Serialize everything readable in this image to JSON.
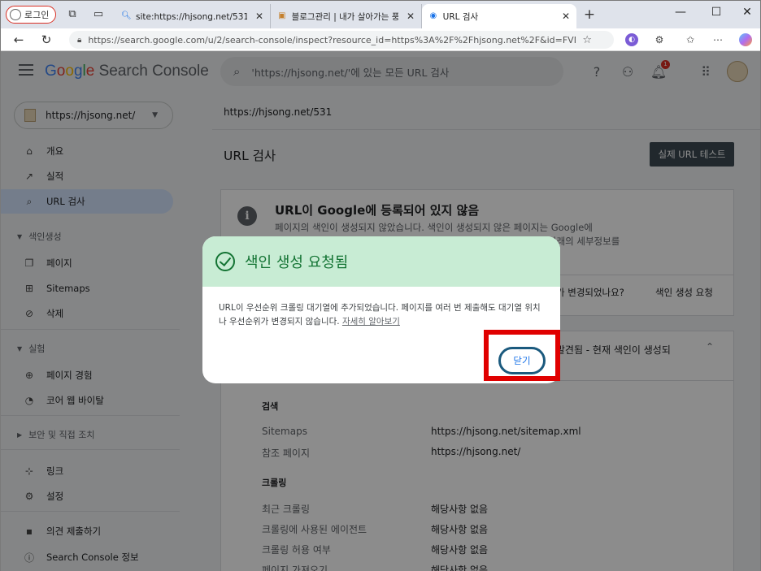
{
  "browser": {
    "login_label": "로그인",
    "tabs": [
      {
        "title": "site:https://hjsong.net/531 - 검색",
        "icon": "search-icon"
      },
      {
        "title": "블로그관리 | 내가 살아가는 풍경",
        "icon": "blog-favicon"
      },
      {
        "title": "URL 검사",
        "icon": "search-console-icon"
      }
    ],
    "new_tab_label": "+",
    "url": "https://search.google.com/u/2/search-console/inspect?resource_id=https%3A%2F%2Fhjsong.net%2F&id=FVN1teDHJHH..."
  },
  "header": {
    "logo": {
      "g1": "G",
      "g2": "o",
      "g3": "o",
      "g4": "g",
      "g5": "l",
      "g6": "e",
      "rest": " Search Console"
    },
    "search_placeholder": "'https://hjsong.net/'에 있는 모든 URL 검사",
    "notification_count": "1"
  },
  "sidebar": {
    "property": "https://hjsong.net/",
    "items": [
      {
        "label": "개요",
        "icon": "home-icon"
      },
      {
        "label": "실적",
        "icon": "trend-icon"
      },
      {
        "label": "URL 검사",
        "icon": "search-icon"
      }
    ],
    "section_index": "색인생성",
    "index_items": [
      {
        "label": "페이지",
        "icon": "pages-icon"
      },
      {
        "label": "Sitemaps",
        "icon": "sitemap-icon"
      },
      {
        "label": "삭제",
        "icon": "removal-icon"
      }
    ],
    "section_experience": "실험",
    "experience_items": [
      {
        "label": "페이지 경험",
        "icon": "add-circle-icon"
      },
      {
        "label": "코어 웹 바이탈",
        "icon": "gauge-icon"
      }
    ],
    "section_security": "보안 및 직접 조치",
    "bottom_items": [
      {
        "label": "링크",
        "icon": "links-icon"
      },
      {
        "label": "설정",
        "icon": "settings-icon"
      }
    ],
    "footer_items": [
      {
        "label": "의견 제출하기",
        "icon": "feedback-icon"
      },
      {
        "label": "Search Console 정보",
        "icon": "info-icon"
      }
    ]
  },
  "main": {
    "breadcrumb": "https://hjsong.net/531",
    "title": "URL 검사",
    "test_button": "실제 URL 테스트",
    "status": {
      "title": "URL이 Google에 등록되어 있지 않음",
      "desc": "페이지의 색인이 생성되지 않았습니다. 색인이 생성되지 않은 페이지는 Google에",
      "desc2": "아래의 세부정보를",
      "question": "가 변경되었나요?",
      "request_link": "색인 생성 요청"
    },
    "details": {
      "header": ": 발견됨 - 현재 색인이 생성되",
      "section_discovery": "검색",
      "rows_discovery": [
        {
          "label": "Sitemaps",
          "value": "https://hjsong.net/sitemap.xml"
        },
        {
          "label": "참조 페이지",
          "value": "https://hjsong.net/"
        }
      ],
      "section_crawl": "크롤링",
      "rows_crawl": [
        {
          "label": "최근 크롤링",
          "value": "해당사항 없음"
        },
        {
          "label": "크롤링에 사용된 에이전트",
          "value": "해당사항 없음"
        },
        {
          "label": "크롤링 허용 여부",
          "value": "해당사항 없음"
        },
        {
          "label": "페이지 가져오기",
          "value": "해당사항 없음"
        }
      ]
    }
  },
  "dialog": {
    "title": "색인 생성 요청됨",
    "body": "URL이 우선순위 크롤링 대기열에 추가되었습니다. 페이지를 여러 번 제출해도 대기열 위치나 우선순위가 변경되지 않습니다.",
    "link": "자세히 알아보기",
    "close": "닫기"
  },
  "colors": {
    "dialog_header": "#c8ecd4",
    "success_green": "#137333",
    "highlight_red": "#e00000",
    "active_nav": "#d3e3fd"
  }
}
